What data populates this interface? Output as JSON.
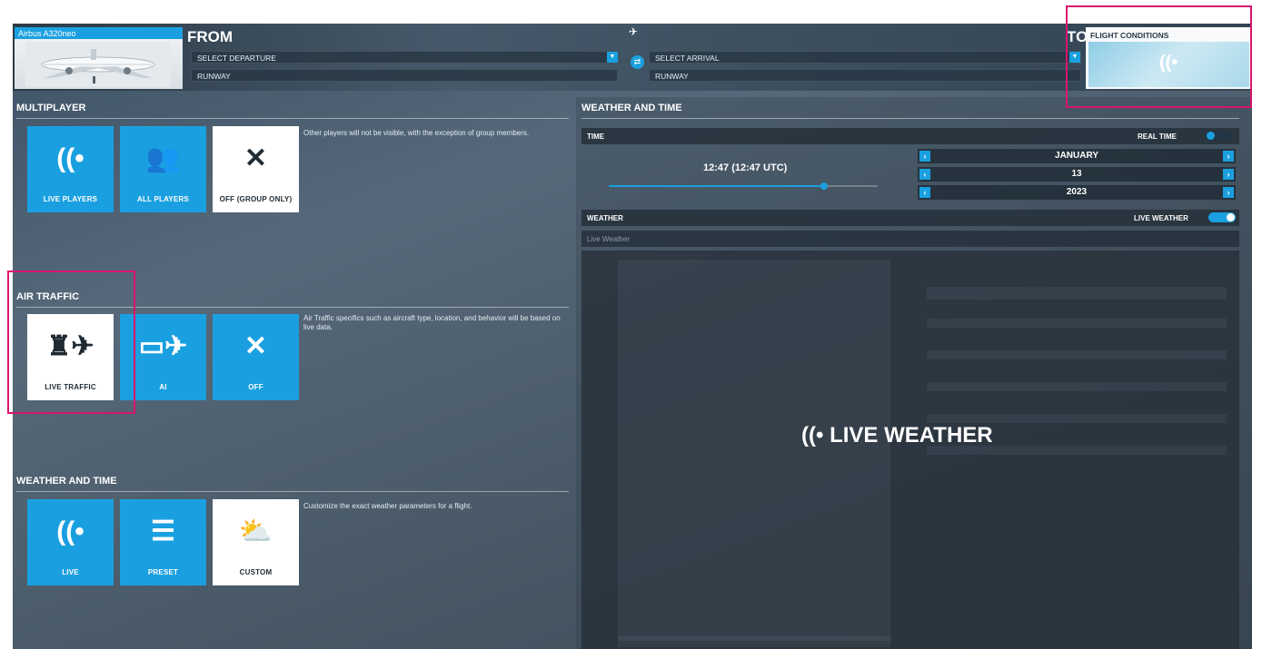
{
  "header": {
    "aircraft_name": "Airbus A320neo",
    "from_label": "FROM",
    "to_label": "TO",
    "departure_placeholder": "SELECT DEPARTURE",
    "arrival_placeholder": "SELECT ARRIVAL",
    "departure_runway": "RUNWAY",
    "arrival_runway": "RUNWAY",
    "swap_icon": "swap-icon",
    "conditions_title": "FLIGHT CONDITIONS",
    "conditions_icon": "live-signal-icon"
  },
  "multiplayer": {
    "title": "MULTIPLAYER",
    "description": "Other players will not be visible, with the exception of group members.",
    "options": [
      {
        "label": "LIVE PLAYERS",
        "icon": "live-signal-icon",
        "glyph": "((•"
      },
      {
        "label": "ALL PLAYERS",
        "icon": "users-icon",
        "glyph": "👥"
      },
      {
        "label": "OFF (GROUP ONLY)",
        "icon": "close-icon",
        "glyph": "✕"
      }
    ],
    "selected": 2
  },
  "air_traffic": {
    "title": "AIR TRAFFIC",
    "description": "Air Traffic specifics such as aircraft type, location, and behavior will be based on live data.",
    "options": [
      {
        "label": "LIVE TRAFFIC",
        "icon": "tower-plane-icon",
        "glyph": "♜✈"
      },
      {
        "label": "AI",
        "icon": "monitor-plane-icon",
        "glyph": "▭✈"
      },
      {
        "label": "OFF",
        "icon": "close-icon",
        "glyph": "✕"
      }
    ],
    "selected": 0
  },
  "weather_time_presets": {
    "title": "WEATHER AND TIME",
    "description": "Customize the exact weather parameters for a flight.",
    "options": [
      {
        "label": "LIVE",
        "icon": "live-signal-icon",
        "glyph": "((•"
      },
      {
        "label": "PRESET",
        "icon": "sliders-icon",
        "glyph": "☰"
      },
      {
        "label": "CUSTOM",
        "icon": "sun-cloud-icon",
        "glyph": "⛅"
      }
    ],
    "selected": 2
  },
  "right_panel": {
    "title": "WEATHER AND TIME",
    "time_label": "TIME",
    "real_time_label": "REAL TIME",
    "time_value": "12:47 (12:47 UTC)",
    "time_slider_fraction": 0.8,
    "month": "JANUARY",
    "day": "13",
    "year": "2023",
    "weather_label": "WEATHER",
    "live_weather_label": "LIVE WEATHER",
    "weather_preset_value": "Live Weather",
    "overlay_text": "LIVE WEATHER",
    "overlay_icon": "live-signal-icon"
  },
  "colors": {
    "accent": "#1aa0e0",
    "highlight": "#d8156e"
  }
}
